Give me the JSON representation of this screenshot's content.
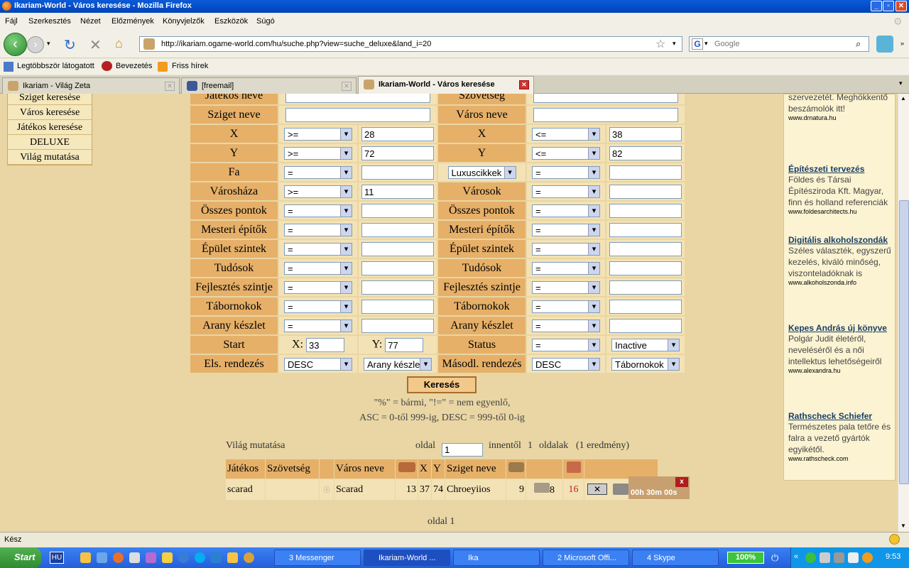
{
  "window": {
    "title": "Ikariam-World - Város keresése - Mozilla Firefox"
  },
  "menu": [
    "Fájl",
    "Szerkesztés",
    "Nézet",
    "Előzmények",
    "Könyvjelzők",
    "Eszközök",
    "Súgó"
  ],
  "nav": {
    "url": "http://ikariam.ogame-world.com/hu/suche.php?view=suche_deluxe&land_i=20",
    "search_placeholder": "Google"
  },
  "bookmarks": [
    "Legtöbbször látogatott",
    "Bevezetés",
    "Friss hírek"
  ],
  "tabs": [
    {
      "label": "Ikariam - Világ Zeta"
    },
    {
      "label": "[freemail]"
    },
    {
      "label": "Ikariam-World - Város keresése"
    }
  ],
  "sidebar": [
    "Sziget keresése",
    "Város keresése",
    "Játékos keresése",
    "DELUXE",
    "Világ mutatása"
  ],
  "form": {
    "top_left": "Játékos neve",
    "top_right": "Szövetség",
    "island_label": "Sziget neve",
    "city_label": "Város neve",
    "rows": [
      {
        "l": "X",
        "lop": ">=",
        "lval": "28",
        "r": "X",
        "rop": "<=",
        "rval": "38"
      },
      {
        "l": "Y",
        "lop": ">=",
        "lval": "72",
        "r": "Y",
        "rop": "<=",
        "rval": "82"
      },
      {
        "l": "Fa",
        "lop": "=",
        "lval": "",
        "r": "Luxuscikkek",
        "rop": "=",
        "rval": ""
      },
      {
        "l": "Városháza",
        "lop": ">=",
        "lval": "11",
        "r": "Városok",
        "rop": "=",
        "rval": ""
      },
      {
        "l": "Összes pontok",
        "lop": "=",
        "lval": "",
        "r": "Összes pontok",
        "rop": "=",
        "rval": ""
      },
      {
        "l": "Mesteri építők",
        "lop": "=",
        "lval": "",
        "r": "Mesteri építők",
        "rop": "=",
        "rval": ""
      },
      {
        "l": "Épület szintek",
        "lop": "=",
        "lval": "",
        "r": "Épület szintek",
        "rop": "=",
        "rval": ""
      },
      {
        "l": "Tudósok",
        "lop": "=",
        "lval": "",
        "r": "Tudósok",
        "rop": "=",
        "rval": ""
      },
      {
        "l": "Fejlesztés szintje",
        "lop": "=",
        "lval": "",
        "r": "Fejlesztés szintje",
        "rop": "=",
        "rval": ""
      },
      {
        "l": "Tábornokok",
        "lop": "=",
        "lval": "",
        "r": "Tábornokok",
        "rop": "=",
        "rval": ""
      },
      {
        "l": "Arany készlet",
        "lop": "=",
        "lval": "",
        "r": "Arany készlet",
        "rop": "=",
        "rval": ""
      }
    ],
    "start_label": "Start",
    "start_x_label": "X:",
    "start_x": "33",
    "start_y_label": "Y:",
    "start_y": "77",
    "status_label": "Status",
    "status_op": "=",
    "status_val": "Inactive",
    "sort1_label": "Els. rendezés",
    "sort1_dir": "DESC",
    "sort1_field": "Arany készlet",
    "sort2_label": "Másodl. rendezés",
    "sort2_dir": "DESC",
    "sort2_field": "Tábornokok",
    "search_button": "Keresés",
    "note1": "\"%\" = bármi, \"!=\" = nem egyenlő,",
    "note2": "ASC = 0-től 999-ig, DESC = 999-től 0-ig"
  },
  "results": {
    "world_link": "Világ mutatása",
    "page_label": "oldal",
    "page_value": "1",
    "from_label": "innentől",
    "total_pages": "1",
    "pages_label": "oldalak",
    "count_label": "(1 eredmény)",
    "headers": [
      "Játékos",
      "Szövetség",
      "",
      "Város neve",
      "",
      "X",
      "Y",
      "Sziget neve",
      ""
    ],
    "row": {
      "player": "scarad",
      "alliance": "",
      "city": "Scarad",
      "city_level": "13",
      "x": "37",
      "y": "74",
      "island": "Chroeyiios",
      "island_level": "9",
      "res": "8",
      "red": "16",
      "timer": "00h 30m 00s",
      "timer_close": "x"
    },
    "footer": "oldal 1"
  },
  "ads": [
    {
      "title": "",
      "desc": "szervezetét. Meghökkentő beszámolók itt!",
      "url": "www.drnatura.hu"
    },
    {
      "title": "Építészeti tervezés",
      "desc": "Földes és Társai Építésziroda Kft. Magyar, finn és holland referenciák",
      "url": "www.foldesarchitects.hu"
    },
    {
      "title": "Digitális alkoholszondák",
      "desc": "Széles választék, egyszerű kezelés, kiváló minőség, viszonteladóknak is",
      "url": "www.alkoholszonda.info"
    },
    {
      "title": "Kepes András új könyve",
      "desc": "Polgár Judit életéről, neveléséről és a női intellektus lehetőségeiről",
      "url": "www.alexandra.hu"
    },
    {
      "title": "Rathscheck Schiefer",
      "desc": "Természetes pala tetőre és falra a vezető gyártók egyikétől.",
      "url": "www.rathscheck.com"
    }
  ],
  "status": {
    "text": "Kész"
  },
  "taskbar": {
    "start": "Start",
    "lang": "HU",
    "tasks": [
      "3 Messenger",
      "Ikariam-World ...",
      "Ika",
      "2 Microsoft Offi...",
      "4 Skype"
    ],
    "battery": "100%",
    "clock": "9:53"
  }
}
